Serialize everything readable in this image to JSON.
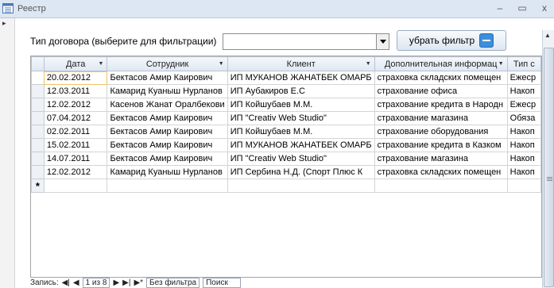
{
  "window": {
    "title": "Реестр",
    "minimize": "–",
    "restore": "▭",
    "close": "x"
  },
  "filter": {
    "label": "Тип договора (выберите для фильтрации)",
    "combo_value": "",
    "remove_filter_label": "убрать фильтр"
  },
  "table": {
    "headers": [
      "Дата",
      "Сотрудник",
      "Клиент",
      "Дополнительная информац",
      "Тип с"
    ],
    "rows": [
      [
        "20.02.2012",
        "Бектасов Амир Каирович",
        "ИП МУКАНОВ ЖАНАТБЕК ОМАРБ",
        "страховка  складских помещен",
        "Ежеср"
      ],
      [
        "12.03.2011",
        "Камарид Куаныш Нурланов",
        "ИП Аубакиров Е.С",
        "страхование офиса",
        "Накоп"
      ],
      [
        "12.02.2012",
        "Касенов Жанат Оралбекови",
        "ИП Койшубаев М.М.",
        "страхование кредита в Народн",
        "Ежеср"
      ],
      [
        "07.04.2012",
        "Бектасов Амир Каирович",
        "ИП \"Creativ Web Studio\"",
        "страхование магазина",
        "Обяза"
      ],
      [
        "02.02.2011",
        "Бектасов Амир Каирович",
        "ИП Койшубаев М.М.",
        "страхование оборудования",
        "Накоп"
      ],
      [
        "15.02.2011",
        "Бектасов Амир Каирович",
        "ИП МУКАНОВ ЖАНАТБЕК ОМАРБ",
        "страхование кредита в Казком",
        "Накоп"
      ],
      [
        "14.07.2011",
        "Бектасов Амир Каирович",
        "ИП \"Creativ Web Studio\"",
        "страхование магазина",
        "Накоп"
      ],
      [
        "12.02.2012",
        "Камарид Куаныш Нурланов",
        "ИП Сербина Н.Д. (Спорт Плюс К",
        "страховка  складских помещен",
        "Накоп"
      ]
    ],
    "new_row_marker": "*"
  },
  "navigation": {
    "record_label": "Запись:",
    "first": "◀|",
    "prev": "◀",
    "current": "1 из 8",
    "next": "▶",
    "last": "▶|",
    "new": "▶*",
    "no_filter_label": "Без фильтра",
    "search_label": "Поиск"
  },
  "icons": {
    "window": "form-icon",
    "filter_button": "filter-clear-icon",
    "combo": "dropdown-arrow-icon"
  }
}
